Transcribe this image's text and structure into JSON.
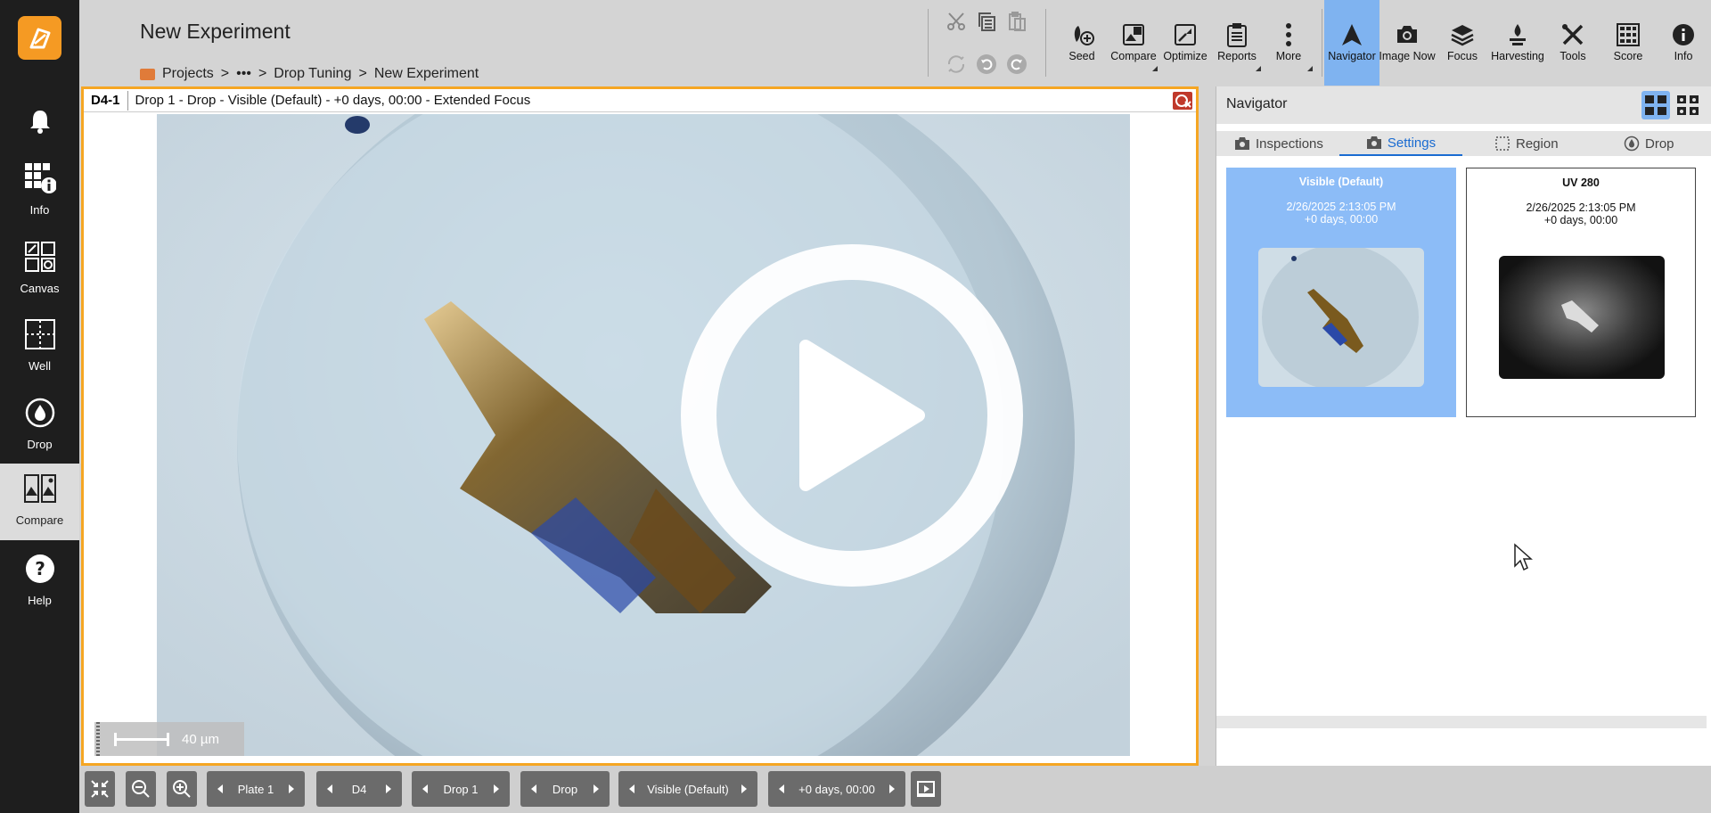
{
  "sidebar": {
    "items": [
      {
        "label": "",
        "icon": "bell-icon"
      },
      {
        "label": "Info",
        "icon": "grid-info-icon"
      },
      {
        "label": "Canvas",
        "icon": "canvas-icon"
      },
      {
        "label": "Well",
        "icon": "well-icon"
      },
      {
        "label": "Drop",
        "icon": "drop-icon"
      },
      {
        "label": "Compare",
        "icon": "compare-icon"
      },
      {
        "label": "Help",
        "icon": "help-icon"
      }
    ]
  },
  "header": {
    "title": "New Experiment",
    "breadcrumb": [
      "Projects",
      ">",
      "•••",
      ">",
      "Drop Tuning",
      ">",
      "New Experiment"
    ]
  },
  "toolbar": {
    "tools": [
      {
        "label": "Seed",
        "icon": "seed-icon"
      },
      {
        "label": "Compare",
        "icon": "compare-image-icon"
      },
      {
        "label": "Optimize",
        "icon": "optimize-icon"
      },
      {
        "label": "Reports",
        "icon": "clipboard-icon"
      },
      {
        "label": "More",
        "icon": "more-vertical-icon"
      },
      {
        "label": "Navigator",
        "icon": "navigator-arrow-icon"
      },
      {
        "label": "Image Now",
        "icon": "camera-icon"
      },
      {
        "label": "Focus",
        "icon": "layers-icon"
      },
      {
        "label": "Harvesting",
        "icon": "harvest-icon"
      },
      {
        "label": "Tools",
        "icon": "tools-icon"
      },
      {
        "label": "Score",
        "icon": "score-grid-icon"
      },
      {
        "label": "Info",
        "icon": "info-icon"
      }
    ]
  },
  "image": {
    "well_id": "D4-1",
    "description": "Drop 1 - Drop - Visible (Default) - +0 days, 00:00 - Extended Focus",
    "scale_label": "40 µm"
  },
  "bottom": {
    "plate": "Plate 1",
    "well": "D4",
    "drop": "Drop 1",
    "region": "Drop",
    "imaging": "Visible (Default)",
    "time": "+0 days, 00:00"
  },
  "navigator": {
    "title": "Navigator",
    "tabs": [
      "Inspections",
      "Settings",
      "Region",
      "Drop"
    ],
    "cards": [
      {
        "title": "Visible (Default)",
        "date": "2/26/2025 2:13:05 PM",
        "age": "+0 days, 00:00"
      },
      {
        "title": "UV 280",
        "date": "2/26/2025 2:13:05 PM",
        "age": "+0 days, 00:00"
      }
    ]
  },
  "colors": {
    "accent": "#f5a623",
    "active_tool": "#7fb3f0",
    "selected_card": "#8cbcf7",
    "tab_active": "#1a6bd1"
  }
}
